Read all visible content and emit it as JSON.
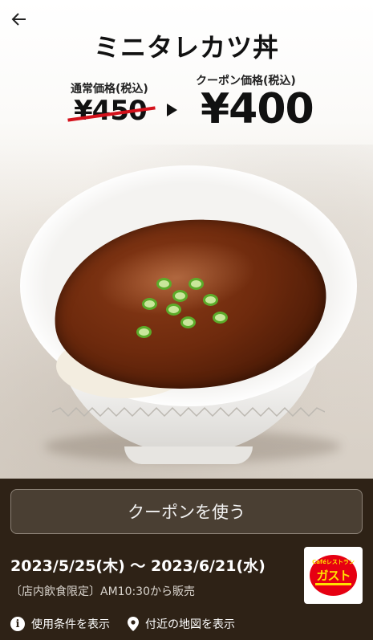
{
  "header": {
    "back_icon": "arrow-left-icon",
    "title": "ミニタレカツ丼"
  },
  "pricing": {
    "regular_label": "通常価格(税込)",
    "regular_price": "¥450",
    "coupon_label": "クーポン価格(税込)",
    "coupon_price": "¥400",
    "strike_color": "#d4121c"
  },
  "actions": {
    "use_coupon_label": "クーポンを使う"
  },
  "validity": {
    "period": "2023/5/25(木) 〜 2023/6/21(水)",
    "note": "〔店内飲食限定〕AM10:30から販売"
  },
  "brand": {
    "logo_small_text": "Caféレストラン",
    "logo_text": "ガスト",
    "logo_color": "#e60012",
    "logo_text_color": "#ffe100"
  },
  "footer_links": [
    {
      "label": "使用条件を表示",
      "icon": "info-icon"
    },
    {
      "label": "付近の地図を表示",
      "icon": "map-pin-icon"
    }
  ]
}
